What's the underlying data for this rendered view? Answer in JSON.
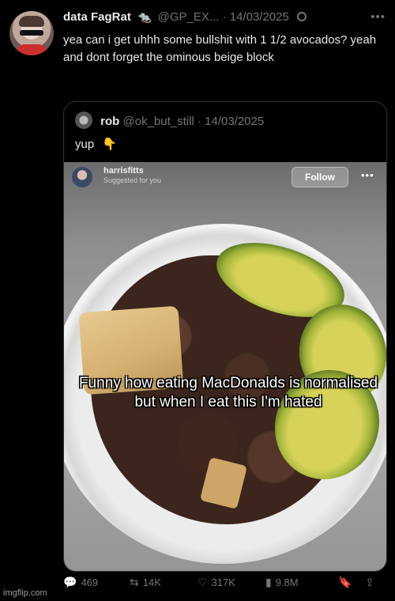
{
  "tweet": {
    "display_name": "data FagRat",
    "handle": "@GP_EX...",
    "date": "14/03/2025",
    "text": "yea can i get uhhh some bullshit with 1 1/2 avocados? yeah and dont forget the ominous beige block"
  },
  "quote": {
    "display_name": "rob",
    "handle": "@ok_but_still",
    "date": "14/03/2025",
    "text": "yup"
  },
  "media": {
    "username": "harrisfitts",
    "subtitle": "Suggested for you",
    "follow_label": "Follow",
    "caption": "Funny how eating MacDonalds is normalised but when I eat this I'm hated"
  },
  "actions": {
    "replies": "469",
    "reposts": "14K",
    "likes": "317K",
    "views": "9.8M"
  },
  "watermark": "imgflip.com",
  "icons": [
    "avatar-icon",
    "grok-icon",
    "more-icon",
    "reply-icon",
    "repost-icon",
    "like-icon",
    "views-icon",
    "bookmark-icon",
    "share-icon",
    "pointing-down-icon"
  ]
}
